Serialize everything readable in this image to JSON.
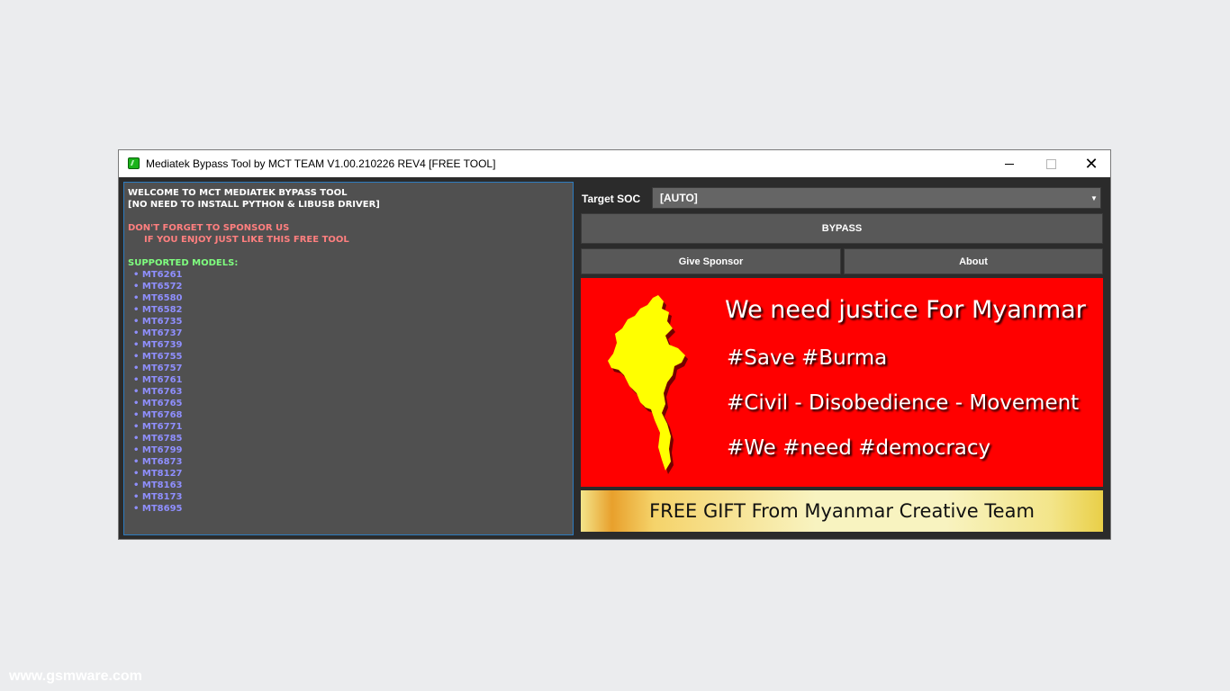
{
  "window": {
    "title": "Mediatek Bypass Tool by MCT TEAM V1.00.210226 REV4 [FREE TOOL]",
    "controls": {
      "minimize": "—",
      "maximize": "☐",
      "close": "✕"
    }
  },
  "log": {
    "lines": [
      {
        "text": "WELCOME TO MCT MEDIATEK BYPASS TOOL",
        "style": "white"
      },
      {
        "text": "[NO NEED TO INSTALL PYTHON & LIBUSB DRIVER]",
        "style": "white"
      },
      {
        "text": "",
        "style": "white"
      },
      {
        "text": "DON'T FORGET TO SPONSOR US",
        "style": "pink"
      },
      {
        "text": "IF YOU ENJOY JUST LIKE THIS FREE TOOL",
        "style": "pink-indent"
      },
      {
        "text": "",
        "style": "white"
      },
      {
        "text": "SUPPORTED MODELS:",
        "style": "green"
      }
    ],
    "models": [
      "MT6261",
      "MT6572",
      "MT6580",
      "MT6582",
      "MT6735",
      "MT6737",
      "MT6739",
      "MT6755",
      "MT6757",
      "MT6761",
      "MT6763",
      "MT6765",
      "MT6768",
      "MT6771",
      "MT6785",
      "MT6799",
      "MT6873",
      "MT8127",
      "MT8163",
      "MT8173",
      "MT8695"
    ],
    "bullet": "•",
    "colors": {
      "white": "#ffffff",
      "pink": "#ff7f7f",
      "green": "#7fff7f",
      "model": "#8f8fff"
    }
  },
  "controls": {
    "target_soc_label": "Target SOC",
    "target_soc_value": "[AUTO]",
    "dropdown_arrow": "▼",
    "bypass_label": "BYPASS",
    "sponsor_label": "Give Sponsor",
    "about_label": "About"
  },
  "banner": {
    "line1": "We need justice For Myanmar",
    "line2": "#Save #Burma",
    "line3": "#Civil - Disobedience - Movement",
    "line4": "#We #need #democracy",
    "background": "#ff0000",
    "map_color": "#ffff00"
  },
  "gift": {
    "text": "FREE GIFT From Myanmar Creative Team"
  },
  "watermark": "www.gsmware.com"
}
